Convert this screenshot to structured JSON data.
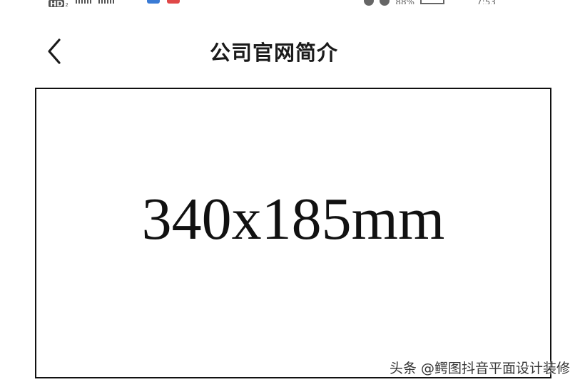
{
  "status_bar": {
    "network_badge": "HD",
    "network_badge_sub": "2",
    "battery_percent": "88%",
    "time": "7:53",
    "app_badge_colors": [
      "#3a7bd5",
      "#e04848"
    ]
  },
  "header": {
    "title": "公司官网简介",
    "back_icon": "chevron-left-icon"
  },
  "image_placeholder": {
    "dimension_label": "340x185mm"
  },
  "watermark": {
    "text": "头条 @鳄图抖音平面设计装修"
  },
  "colors": {
    "background": "#ffffff",
    "frame_border": "#111111",
    "title_text": "#1a1a1a"
  }
}
